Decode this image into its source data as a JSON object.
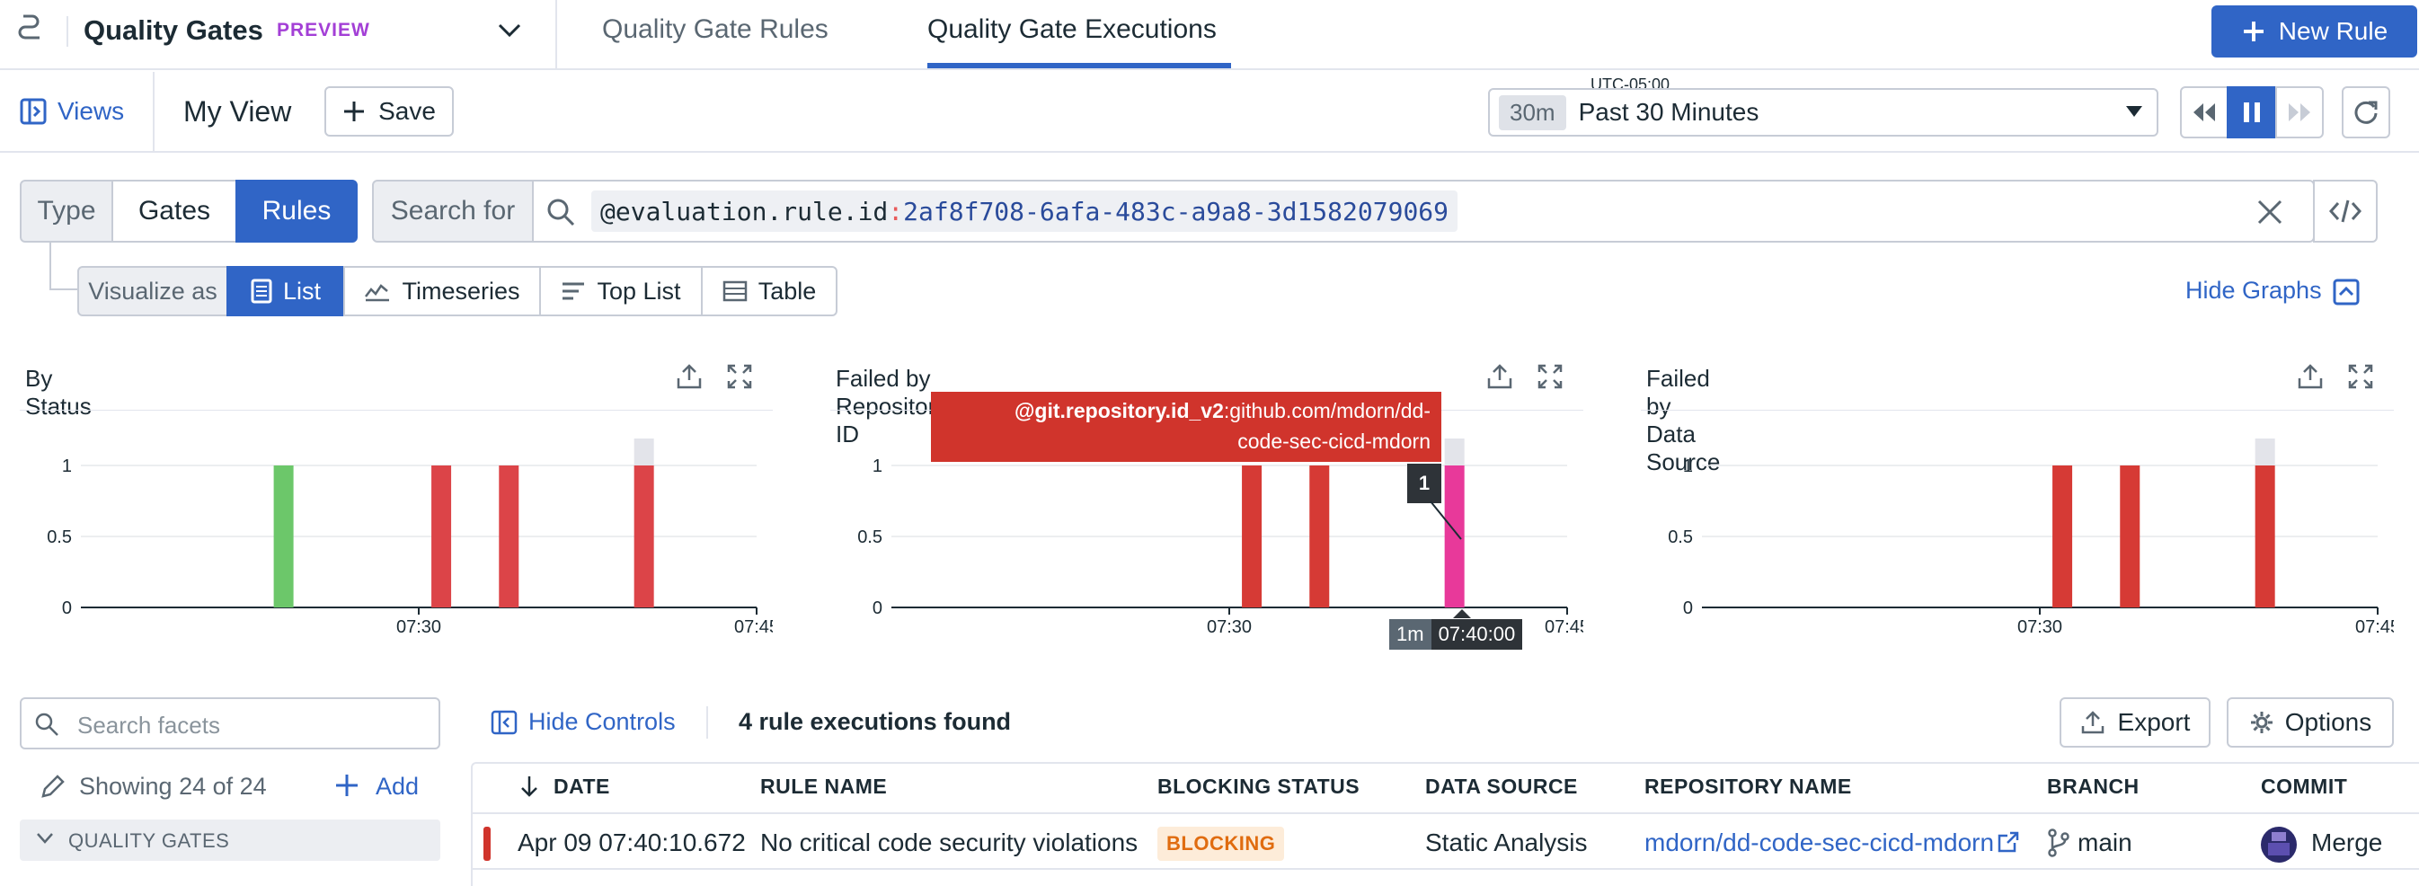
{
  "topbar": {
    "title": "Quality Gates",
    "badge": "PREVIEW",
    "tabs": [
      {
        "label": "Quality Gate Rules",
        "active": false
      },
      {
        "label": "Quality Gate Executions",
        "active": true
      }
    ],
    "new_rule_label": "New Rule"
  },
  "viewbar": {
    "views_label": "Views",
    "view_name": "My View",
    "save_label": "Save",
    "timezone": "UTC-05:00",
    "time_badge": "30m",
    "time_range": "Past 30 Minutes"
  },
  "query": {
    "type_label": "Type",
    "type_options": [
      "Gates",
      "Rules"
    ],
    "type_selected": "Rules",
    "search_for_label": "Search for",
    "query_key": "@evaluation.rule.id",
    "query_sep": ":",
    "query_value": "2af8f708-6afa-483c-a9a8-3d1582079069"
  },
  "visualize": {
    "label": "Visualize as",
    "options": [
      "List",
      "Timeseries",
      "Top List",
      "Table"
    ],
    "selected": "List",
    "hide_graphs_label": "Hide Graphs"
  },
  "chart_data": [
    {
      "type": "bar",
      "title": "By Status",
      "x_ticks": [
        "07:30",
        "07:45"
      ],
      "y_ticks": [
        "0",
        "0.5",
        "1"
      ],
      "ylim": [
        0,
        1
      ],
      "series": [
        {
          "color": "#6cc76a",
          "points": [
            {
              "x": "07:24",
              "y": 1
            }
          ]
        },
        {
          "color": "#dc4448",
          "points": [
            {
              "x": "07:31",
              "y": 1
            },
            {
              "x": "07:34",
              "y": 1
            },
            {
              "x": "07:40",
              "y": 1
            }
          ]
        }
      ]
    },
    {
      "type": "bar",
      "title": "Failed by Repository ID",
      "x_ticks": [
        "07:30",
        "07:45"
      ],
      "y_ticks": [
        "0",
        "0.5",
        "1"
      ],
      "ylim": [
        0,
        1
      ],
      "series": [
        {
          "color": "#d63a35",
          "points": [
            {
              "x": "07:31",
              "y": 1
            },
            {
              "x": "07:34",
              "y": 1
            }
          ]
        },
        {
          "color": "#e8399a",
          "points": [
            {
              "x": "07:40",
              "y": 1
            }
          ]
        }
      ],
      "tooltip": {
        "key": "@git.repository.id_v2",
        "value_line1": ":github.com/mdorn/dd-",
        "value_line2": "code-sec-cicd-mdorn",
        "count": "1",
        "interval": "1m",
        "time": "07:40:00"
      }
    },
    {
      "type": "bar",
      "title": "Failed by Data Source",
      "x_ticks": [
        "07:30",
        "07:45"
      ],
      "y_ticks": [
        "0",
        "0.5",
        "1"
      ],
      "ylim": [
        0,
        1
      ],
      "series": [
        {
          "color": "#d63a35",
          "points": [
            {
              "x": "07:31",
              "y": 1
            },
            {
              "x": "07:34",
              "y": 1
            },
            {
              "x": "07:40",
              "y": 1
            }
          ]
        }
      ]
    }
  ],
  "facets": {
    "search_placeholder": "Search facets",
    "showing": "Showing 24 of 24",
    "add_label": "Add",
    "section": "QUALITY GATES"
  },
  "results": {
    "hide_controls_label": "Hide Controls",
    "count_text": "4 rule executions found",
    "export_label": "Export",
    "options_label": "Options",
    "columns": [
      "DATE",
      "RULE NAME",
      "BLOCKING STATUS",
      "DATA SOURCE",
      "REPOSITORY NAME",
      "BRANCH",
      "COMMIT"
    ],
    "rows": [
      {
        "date": "Apr 09 07:40:10.672",
        "rule_name": "No critical code security violations",
        "blocking_status": "BLOCKING",
        "data_source": "Static Analysis",
        "repository": "mdorn/dd-code-sec-cicd-mdorn",
        "branch": "main",
        "commit": "Merge"
      }
    ]
  }
}
